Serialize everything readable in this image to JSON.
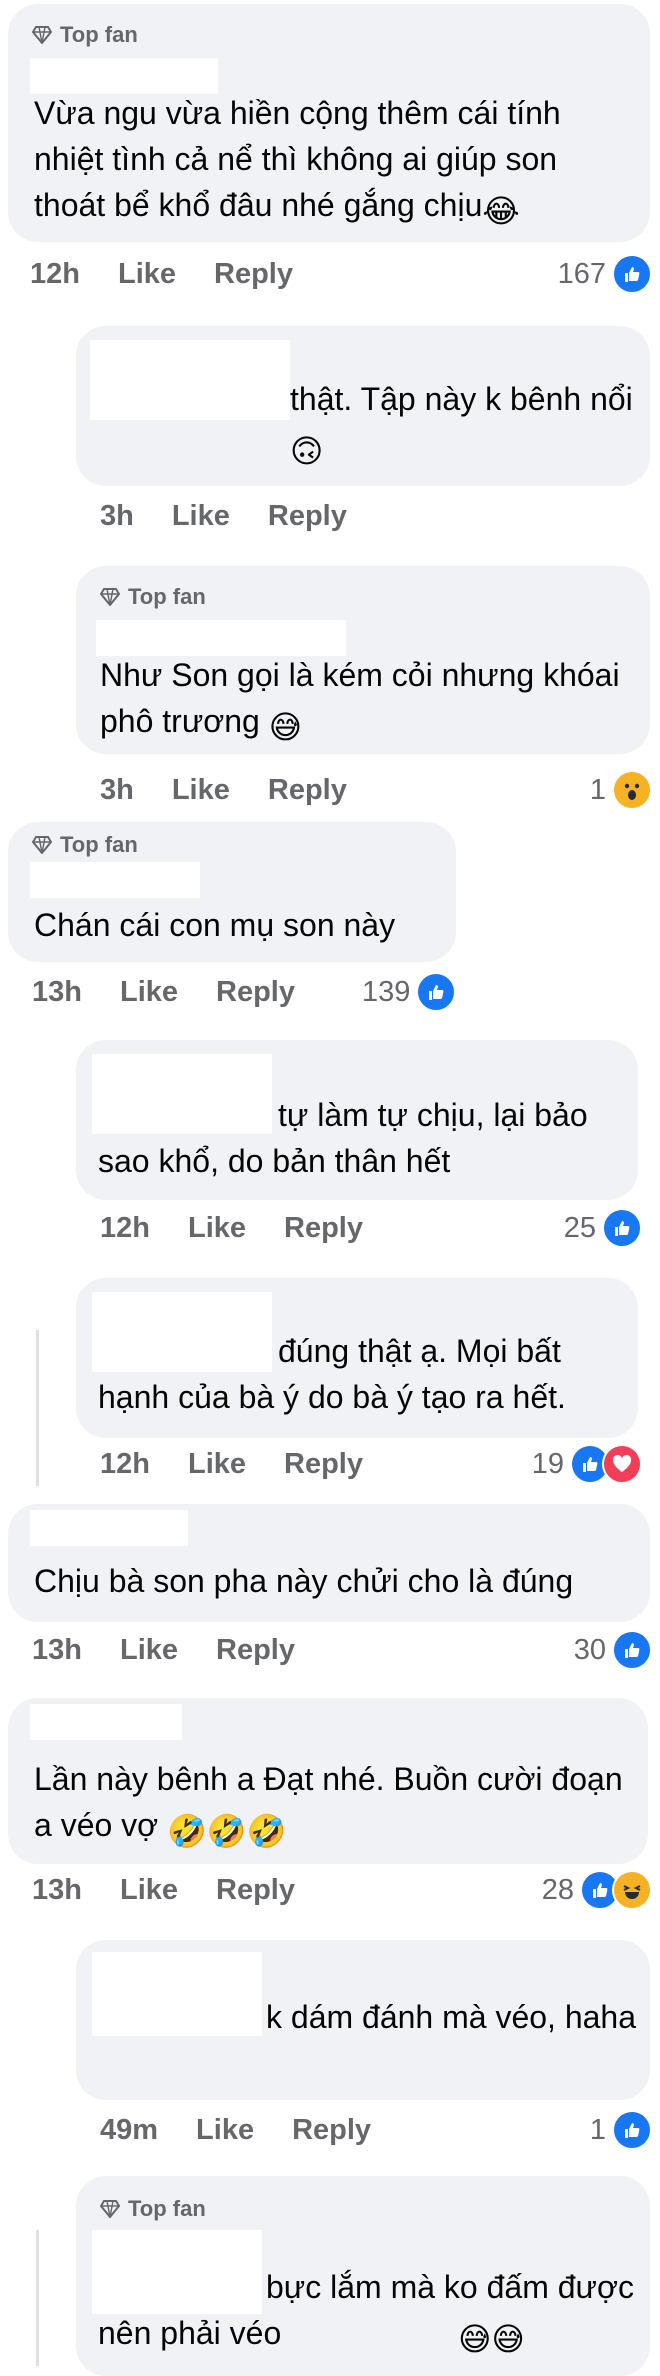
{
  "top_fan_label": "Top fan",
  "like_label": "Like",
  "reply_label": "Reply",
  "comments": [
    {
      "text": "Vừa ngu vừa hiền cộng thêm cái tính nhiệt tình cả nể thì không ai giúp son thoát bể khổ đâu nhé gắng chịu",
      "emoji": "😂",
      "time": "12h",
      "count": "167"
    },
    {
      "text": "thật. Tập này k bênh nổi",
      "emoji": "🙃",
      "time": "3h",
      "count": ""
    },
    {
      "text": "Như Son gọi là kém cỏi nhưng khóai phô trương",
      "emoji": "😅",
      "time": "3h",
      "count": "1"
    },
    {
      "text": "Chán cái con mụ son này",
      "time": "13h",
      "count": "139"
    },
    {
      "text": "tự làm tự chịu, lại bảo sao khổ, do bản thân hết",
      "time": "12h",
      "count": "25"
    },
    {
      "text": "đúng thật ạ. Mọi bất hạnh của bà ý do bà ý tạo ra hết.",
      "time": "12h",
      "count": "19"
    },
    {
      "text": "Chịu bà son pha này chửi cho là đúng",
      "time": "13h",
      "count": "30"
    },
    {
      "text": "Lần này bênh a Đạt nhé. Buồn cười đoạn a véo vợ",
      "emoji": "🤣🤣🤣",
      "time": "13h",
      "count": "28"
    },
    {
      "text": "k dám đánh mà véo, haha",
      "time": "49m",
      "count": "1"
    },
    {
      "text": "bực lắm mà ko đấm được nên phải véo",
      "emoji": "😅😅"
    }
  ],
  "icons": {
    "like": "like-reaction-icon",
    "love": "love-reaction-icon",
    "wow": "wow-reaction-icon",
    "haha": "haha-reaction-icon",
    "badge": "diamond-badge-icon"
  },
  "colors": {
    "bubble": "#f0f2f5",
    "meta": "#65676b",
    "like": "#1877f2",
    "love": "#f33e58",
    "reaction_yellow": "#f7b125"
  }
}
